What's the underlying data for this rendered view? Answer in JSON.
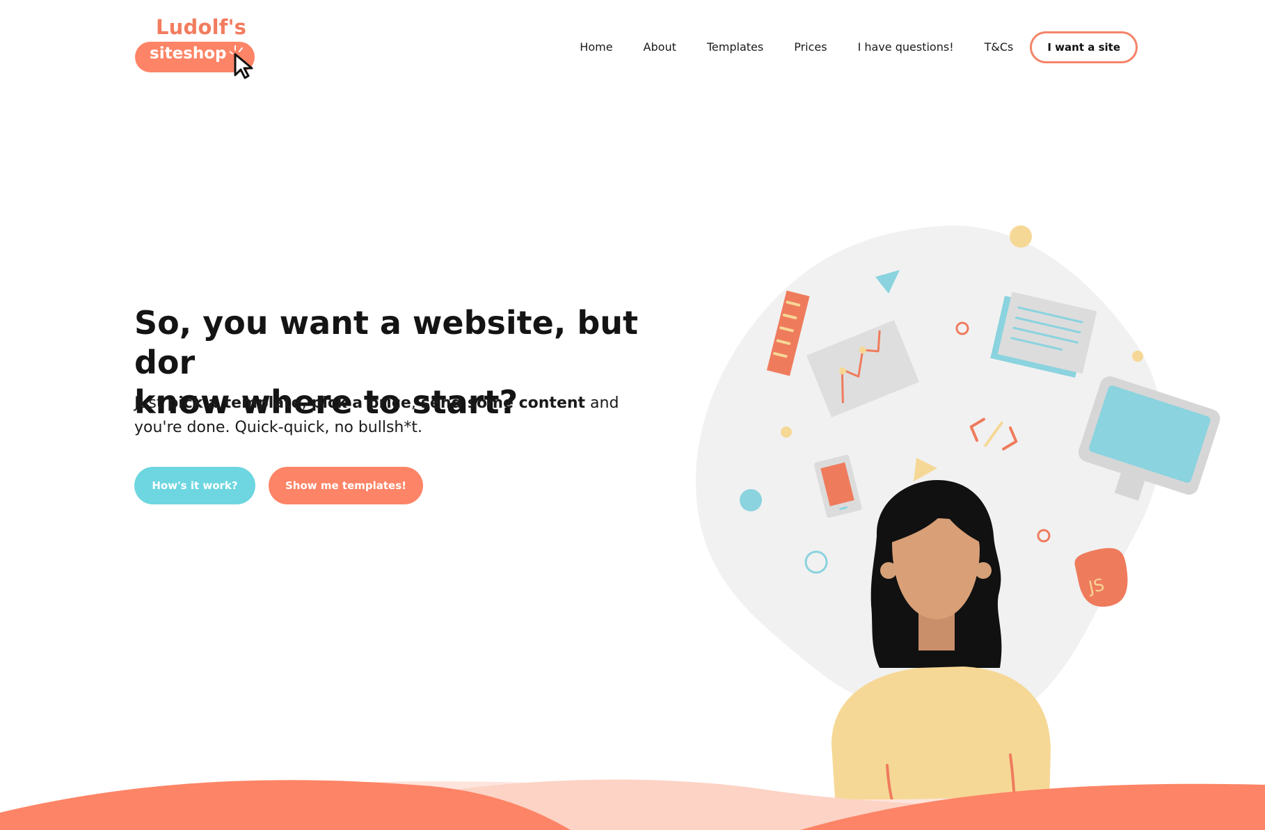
{
  "header": {
    "logo_top": "Ludolf's",
    "logo_bottom": "siteshop",
    "nav": [
      {
        "label": "Home"
      },
      {
        "label": "About"
      },
      {
        "label": "Templates"
      },
      {
        "label": "Prices"
      },
      {
        "label": "I have questions!"
      },
      {
        "label": "T&Cs"
      }
    ],
    "cta_label": "I want a site"
  },
  "hero": {
    "title": "So, you want a website, but dor\nknow where to start?",
    "sub_just": "Just ",
    "sub_pick_template": "pick a template",
    "sub_comma1": ", ",
    "sub_pick_price": "pick a price",
    "sub_comma2": ", ",
    "sub_send_content": "send some content",
    "sub_rest": " and you're done. Quick-quick, no bullsh*t.",
    "button_how": "How's it work?",
    "button_templates": "Show me templates!"
  },
  "illustration": {
    "code_tag": "</>",
    "js_badge": "JS"
  },
  "colors": {
    "coral": "#fd8466",
    "teal": "#6dd6e0",
    "yellow": "#f6d896",
    "blob": "#f1f1f1"
  }
}
